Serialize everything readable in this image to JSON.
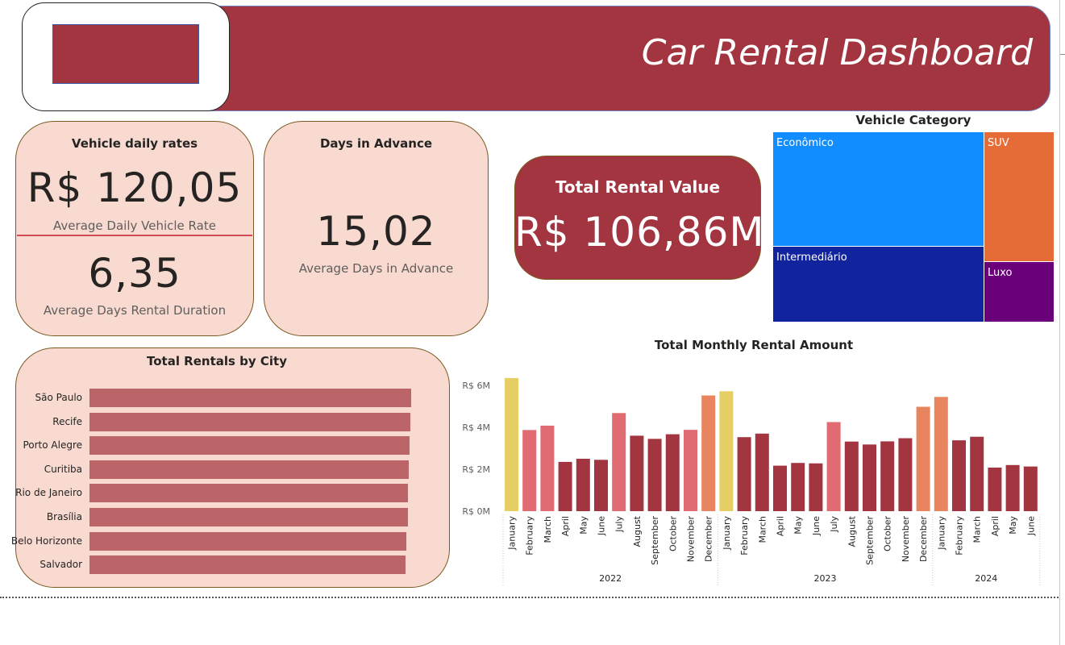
{
  "header": {
    "title": "Car Rental Dashboard",
    "color": "#a23540"
  },
  "kpi_daily": {
    "title": "Vehicle daily rates",
    "value": "R$ 120,05",
    "subtitle": "Average Daily Vehicle Rate",
    "duration_value": "6,35",
    "duration_subtitle": "Average Days Rental Duration"
  },
  "kpi_advance": {
    "title": "Days in Advance",
    "value": "15,02",
    "subtitle": "Average Days in Advance"
  },
  "kpi_total": {
    "title": "Total Rental Value",
    "value": "R$ 106,86M"
  },
  "treemap": {
    "title": "Vehicle Category",
    "tiles": [
      {
        "label": "Econômico",
        "color": "#118dff"
      },
      {
        "label": "Intermediário",
        "color": "#12239e"
      },
      {
        "label": "SUV",
        "color": "#e66c37"
      },
      {
        "label": "Luxo",
        "color": "#6b007b"
      }
    ]
  },
  "city_chart": {
    "title": "Total Rentals by City",
    "bar_color": "#bb6568",
    "cities": [
      {
        "name": "São Paulo",
        "value": 1.0
      },
      {
        "name": "Recife",
        "value": 0.997
      },
      {
        "name": "Porto Alegre",
        "value": 0.995
      },
      {
        "name": "Curitiba",
        "value": 0.992
      },
      {
        "name": "Rio de Janeiro",
        "value": 0.99
      },
      {
        "name": "Brasília",
        "value": 0.99
      },
      {
        "name": "Belo Horizonte",
        "value": 0.985
      },
      {
        "name": "Salvador",
        "value": 0.983
      }
    ]
  },
  "chart_data": {
    "type": "bar",
    "title": "Total Monthly Rental Amount",
    "ylabel": "",
    "xlabel": "",
    "y_ticks": [
      "R$ 0M",
      "R$ 2M",
      "R$ 4M",
      "R$ 6M"
    ],
    "ylim": [
      0,
      6.5
    ],
    "groups": [
      {
        "label": "2022",
        "months": [
          "January",
          "February",
          "March",
          "April",
          "May",
          "June",
          "July",
          "August",
          "September",
          "October",
          "November",
          "December"
        ]
      },
      {
        "label": "2023",
        "months": [
          "January",
          "February",
          "March",
          "April",
          "May",
          "June",
          "July",
          "August",
          "September",
          "October",
          "November",
          "December"
        ]
      },
      {
        "label": "2024",
        "months": [
          "January",
          "February",
          "March",
          "April",
          "May",
          "June"
        ]
      }
    ],
    "values": [
      6.35,
      3.87,
      4.08,
      2.35,
      2.5,
      2.45,
      4.68,
      3.6,
      3.45,
      3.67,
      3.88,
      5.52,
      5.72,
      3.53,
      3.7,
      2.17,
      2.3,
      2.28,
      4.25,
      3.32,
      3.18,
      3.33,
      3.48,
      4.98,
      5.45,
      3.38,
      3.55,
      2.08,
      2.2,
      2.13
    ],
    "colors": [
      "#e5cf64",
      "#e06b73",
      "#e06b73",
      "#a23540",
      "#a23540",
      "#a23540",
      "#e06b73",
      "#a23540",
      "#a23540",
      "#a23540",
      "#e06b73",
      "#e8855f",
      "#e5cf64",
      "#a23540",
      "#a23540",
      "#a23540",
      "#a23540",
      "#a23540",
      "#e06b73",
      "#a23540",
      "#a23540",
      "#a23540",
      "#a23540",
      "#e8855f",
      "#e8855f",
      "#a23540",
      "#a23540",
      "#a23540",
      "#a23540",
      "#a23540"
    ]
  }
}
